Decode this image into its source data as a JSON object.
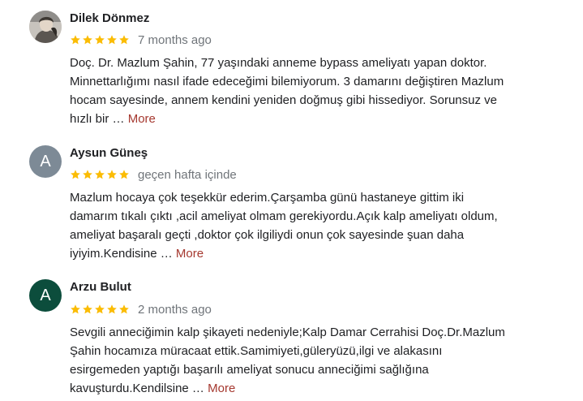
{
  "colors": {
    "star": "#fbbc04",
    "more_link": "#a5382f",
    "meta_text": "#70757a",
    "avatar_aysun": "#7d8a96",
    "avatar_arzu": "#0c4d3c"
  },
  "reviews": [
    {
      "author": "Dilek Dönmez",
      "avatar": "profile-photo",
      "rating": 5,
      "date": "7 months ago",
      "lines": [
        "Doç. Dr. Mazlum Şahin, 77 yaşındaki anneme bypass ameliyatı yapan doktor.",
        "Minnettarlığımı nasıl ifade edeceğimi bilemiyorum. 3 damarını değiştiren Mazlum",
        "hocam sayesinde, annem kendini yeniden doğmuş gibi hissediyor. Sorunsuz ve",
        "hızlı bir"
      ],
      "ellipsis": " … ",
      "more_label": "More"
    },
    {
      "author": "Aysun Güneş",
      "avatar_letter": "A",
      "rating": 5,
      "date": "geçen hafta içinde",
      "lines": [
        "Mazlum hocaya çok teşekkür ederim.Çarşamba günü hastaneye gittim iki",
        "damarım tıkalı çıktı ,acil ameliyat olmam gerekiyordu.Açık kalp ameliyatı oldum,",
        "ameliyat başaralı geçti ,doktor çok ilgiliydi onun çok sayesinde şuan daha",
        "iyiyim.Kendisine"
      ],
      "ellipsis": " … ",
      "more_label": "More"
    },
    {
      "author": "Arzu Bulut",
      "avatar_letter": "A",
      "rating": 5,
      "date": "2 months ago",
      "lines": [
        "Sevgili anneciğimin kalp şikayeti nedeniyle;Kalp Damar Cerrahisi Doç.Dr.Mazlum",
        "Şahin hocamıza müracaat ettik.Samimiyeti,güleryüzü,ilgi ve alakasını",
        "esirgemeden yaptığı başarılı ameliyat sonucu anneciğimi sağlığına",
        "kavuşturdu.Kendilsine"
      ],
      "ellipsis": " … ",
      "more_label": "More"
    }
  ]
}
